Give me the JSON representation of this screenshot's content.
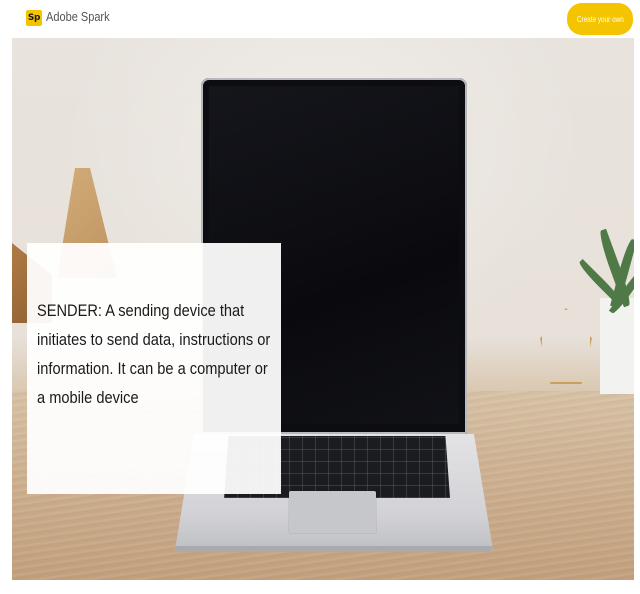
{
  "header": {
    "logo_text": "Sp",
    "app_name": "Adobe Spark",
    "cta_label": "Create your own"
  },
  "hero": {
    "image_alt": "laptop-on-desk-photo",
    "card_text": "SENDER: A sending device that initiates to send data, instructions or information. It can be a computer or a mobile device"
  },
  "colors": {
    "accent": "#f5c400",
    "text": "#1a1a1a"
  }
}
